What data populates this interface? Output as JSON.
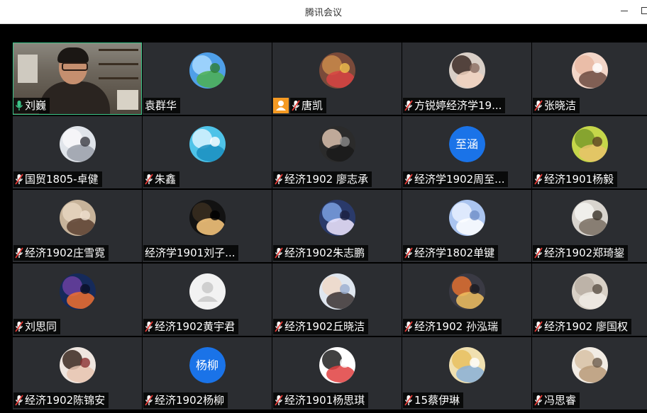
{
  "window": {
    "title": "腾讯会议"
  },
  "participants": [
    {
      "name": "刘巍",
      "mic": "on",
      "video": true
    },
    {
      "name": "袁群华",
      "mic": "none",
      "avatar": "landscape"
    },
    {
      "name": "唐凯",
      "mic": "muted",
      "avatar": "cat-flowers",
      "host": true
    },
    {
      "name": "方锐婷经济学19...",
      "mic": "muted",
      "avatar": "girl"
    },
    {
      "name": "张晓洁",
      "mic": "muted",
      "avatar": "baby"
    },
    {
      "name": "国贸1805-卓健",
      "mic": "muted",
      "avatar": "anime-white"
    },
    {
      "name": "朱鑫",
      "mic": "muted",
      "avatar": "sea-pier"
    },
    {
      "name": "经济1902 廖志承",
      "mic": "muted",
      "avatar": "boy-dark"
    },
    {
      "name": "经济学1902周至...",
      "mic": "muted",
      "avatar_text": "至涵"
    },
    {
      "name": "经济1901杨毅",
      "mic": "muted",
      "avatar": "cartoon-green"
    },
    {
      "name": "经济1902庄雪霓",
      "mic": "muted",
      "avatar": "girl-soft"
    },
    {
      "name": "经济学1901刘子...",
      "mic": "none",
      "avatar": "night-light"
    },
    {
      "name": "经济1902朱志鹏",
      "mic": "muted",
      "avatar": "anime-blue"
    },
    {
      "name": "经济学1802单键",
      "mic": "muted",
      "avatar": "angel"
    },
    {
      "name": "经济1902郑琦鋆",
      "mic": "muted",
      "avatar": "cat-white"
    },
    {
      "name": " 刘思同",
      "mic": "muted",
      "avatar": "night-city"
    },
    {
      "name": "经济1902黄宇君",
      "mic": "muted",
      "avatar": "default"
    },
    {
      "name": "经济1902丘晓洁",
      "mic": "muted",
      "avatar": "boy-light"
    },
    {
      "name": "经济1902 孙泓瑞",
      "mic": "muted",
      "avatar": "warrior"
    },
    {
      "name": "经济1902 廖国权",
      "mic": "muted",
      "avatar": "cat-gray"
    },
    {
      "name": "经济1902陈锦安",
      "mic": "muted",
      "avatar": "woman"
    },
    {
      "name": "经济1902杨柳",
      "mic": "muted",
      "avatar_text": "杨柳"
    },
    {
      "name": "经济1901杨思琪",
      "mic": "muted",
      "avatar": "sketch"
    },
    {
      "name": "15蔡伊琳",
      "mic": "muted",
      "avatar": "anime-blonde"
    },
    {
      "name": "冯思睿",
      "mic": "muted",
      "avatar": "bear"
    }
  ],
  "colors": {
    "tile_bg": "#2b2d31",
    "active_border": "#3cc68a",
    "mic_on": "#3cc68a",
    "mic_muted": "#e53935",
    "host_badge": "#f59a23",
    "text_avatar_bg": "#1a73e8"
  }
}
